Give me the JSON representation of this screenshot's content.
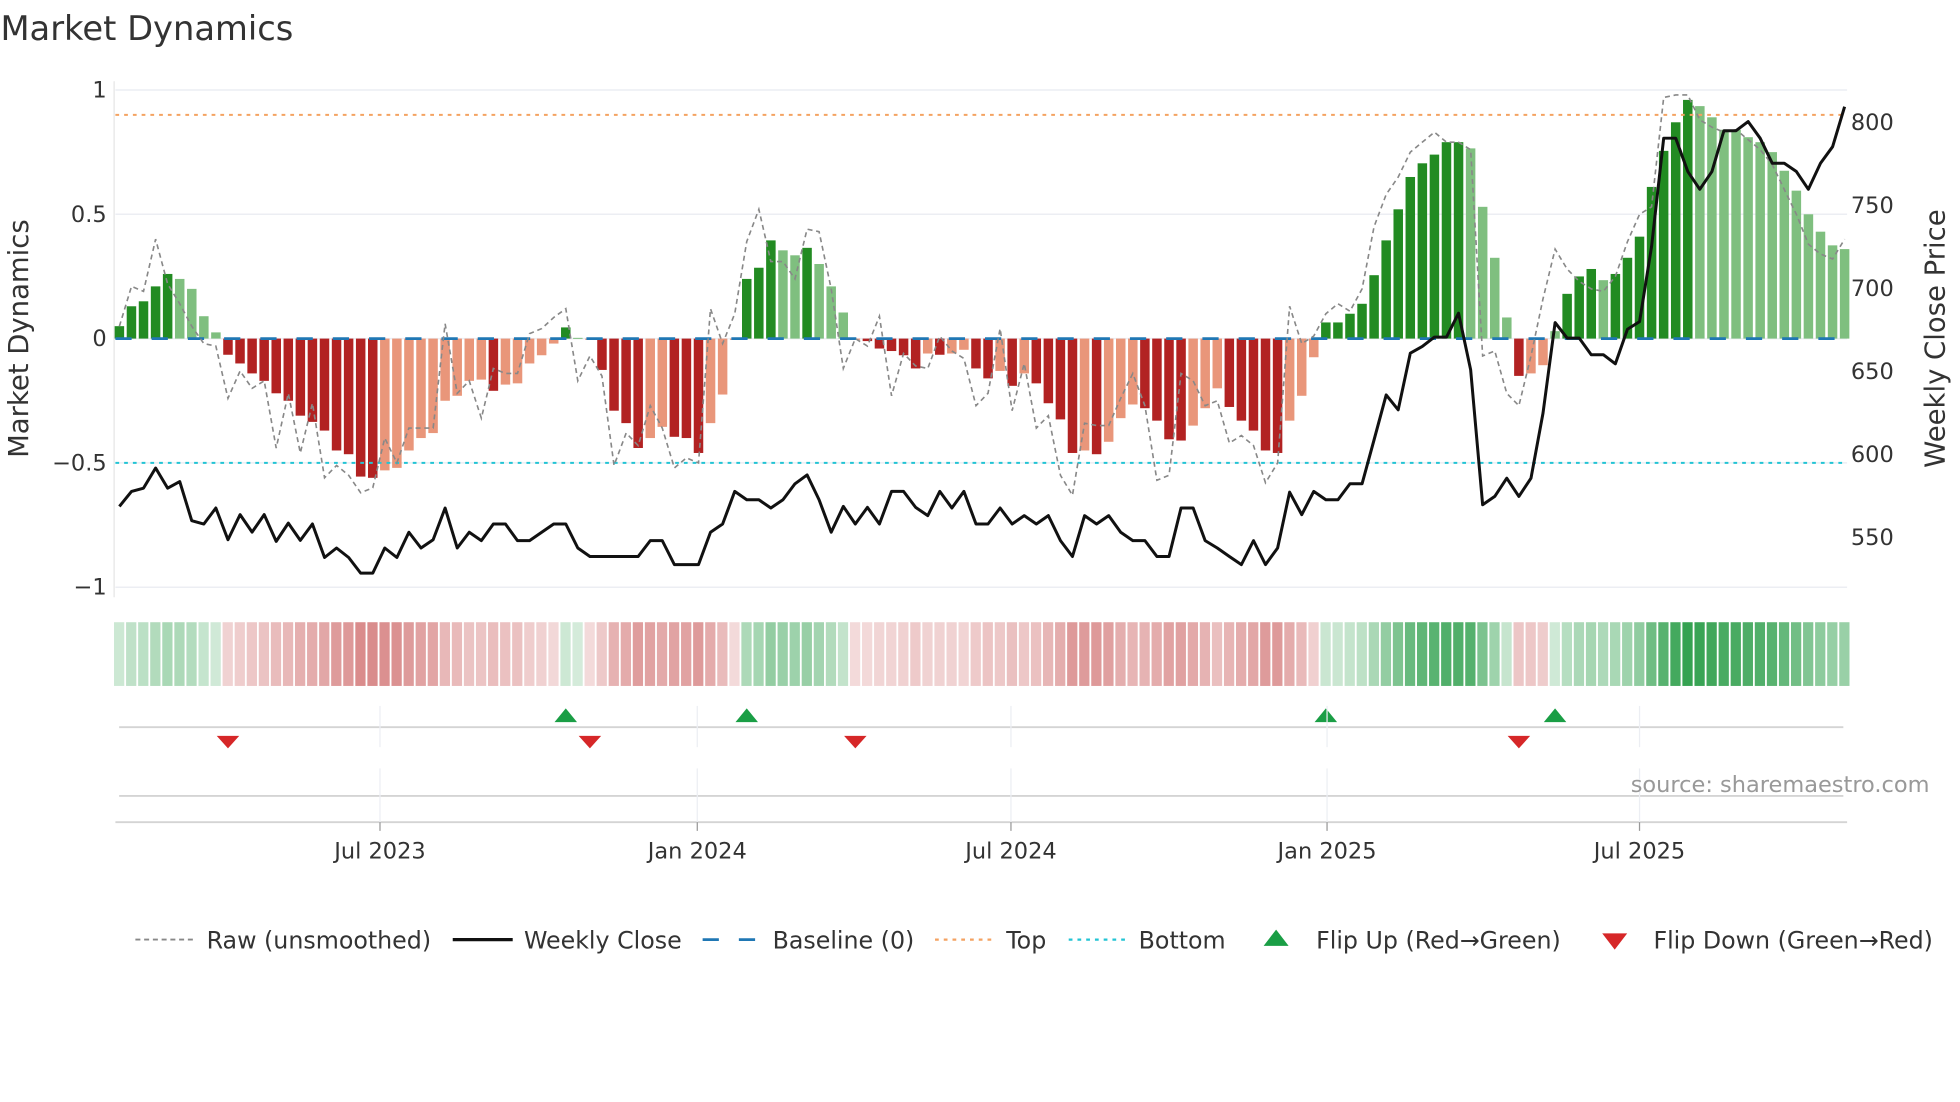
{
  "chart_data": {
    "type": "bar",
    "title": "Market Dynamics",
    "ylabel": "Market Dynamics",
    "y2label": "Weekly Close Price",
    "ylim": [
      -1,
      1
    ],
    "y2lim": [
      520,
      826
    ],
    "yticks": [
      {
        "v": 1,
        "label": "1"
      },
      {
        "v": 0.5,
        "label": "0.5"
      },
      {
        "v": 0,
        "label": "0"
      },
      {
        "v": -0.5,
        "label": "−0.5"
      },
      {
        "v": -1,
        "label": "−1"
      }
    ],
    "y2ticks": [
      {
        "v": 800,
        "label": "800"
      },
      {
        "v": 750,
        "label": "750"
      },
      {
        "v": 700,
        "label": "700"
      },
      {
        "v": 650,
        "label": "650"
      },
      {
        "v": 600,
        "label": "600"
      },
      {
        "v": 550,
        "label": "550"
      }
    ],
    "xticks": [
      {
        "week": 22.6,
        "label": "Jul 2023"
      },
      {
        "week": 48.9,
        "label": "Jan 2024"
      },
      {
        "week": 74.9,
        "label": "Jul 2024"
      },
      {
        "week": 101.1,
        "label": "Jan 2025"
      },
      {
        "week": 127,
        "label": "Jul 2025"
      }
    ],
    "frequency": "weekly",
    "reference_lines": {
      "top": 0.9,
      "bottom": -0.5,
      "baseline": 0
    },
    "smoothed": [
      0.05,
      0.13,
      0.15,
      0.21,
      0.26,
      0.24,
      0.2,
      0.09,
      0.025,
      -0.065,
      -0.1,
      -0.14,
      -0.17,
      -0.22,
      -0.25,
      -0.31,
      -0.335,
      -0.37,
      -0.45,
      -0.465,
      -0.555,
      -0.56,
      -0.53,
      -0.52,
      -0.45,
      -0.4,
      -0.38,
      -0.25,
      -0.23,
      -0.17,
      -0.165,
      -0.21,
      -0.185,
      -0.18,
      -0.1,
      -0.067,
      -0.02,
      0.045,
      0.003,
      -0.005,
      -0.126,
      -0.29,
      -0.34,
      -0.44,
      -0.4,
      -0.355,
      -0.395,
      -0.4,
      -0.46,
      -0.34,
      -0.225,
      -0.005,
      0.24,
      0.285,
      0.395,
      0.355,
      0.335,
      0.365,
      0.3,
      0.21,
      0.105,
      -0.005,
      -0.01,
      -0.04,
      -0.05,
      -0.067,
      -0.12,
      -0.06,
      -0.065,
      -0.06,
      -0.045,
      -0.12,
      -0.16,
      -0.13,
      -0.19,
      -0.14,
      -0.18,
      -0.26,
      -0.325,
      -0.46,
      -0.45,
      -0.465,
      -0.415,
      -0.32,
      -0.265,
      -0.28,
      -0.33,
      -0.405,
      -0.41,
      -0.35,
      -0.28,
      -0.2,
      -0.275,
      -0.33,
      -0.37,
      -0.45,
      -0.46,
      -0.33,
      -0.23,
      -0.075,
      0.065,
      0.065,
      0.1,
      0.14,
      0.255,
      0.395,
      0.52,
      0.65,
      0.705,
      0.74,
      0.79,
      0.79,
      0.765,
      0.53,
      0.325,
      0.085,
      -0.15,
      -0.14,
      -0.107,
      0.03,
      0.18,
      0.25,
      0.28,
      0.235,
      0.26,
      0.325,
      0.41,
      0.61,
      0.755,
      0.87,
      0.96,
      0.935,
      0.89,
      0.84,
      0.84,
      0.81,
      0.79,
      0.75,
      0.675,
      0.595,
      0.5,
      0.43,
      0.375,
      0.36
    ],
    "state": [
      "DG",
      "DG",
      "DG",
      "DG",
      "DG",
      "LG",
      "LG",
      "LG",
      "LG",
      "DR",
      "DR",
      "DR",
      "DR",
      "DR",
      "DR",
      "DR",
      "DR",
      "DR",
      "DR",
      "DR",
      "DR",
      "DR",
      "LR",
      "LR",
      "LR",
      "LR",
      "LR",
      "LR",
      "LR",
      "LR",
      "LR",
      "DR",
      "LR",
      "LR",
      "LR",
      "LR",
      "LR",
      "DG",
      "LG",
      "LR",
      "DR",
      "DR",
      "DR",
      "DR",
      "LR",
      "LR",
      "DR",
      "DR",
      "DR",
      "LR",
      "LR",
      "LR",
      "DG",
      "DG",
      "DG",
      "LG",
      "LG",
      "DG",
      "LG",
      "LG",
      "LG",
      "LR",
      "DR",
      "DR",
      "DR",
      "DR",
      "DR",
      "LR",
      "DR",
      "LR",
      "LR",
      "DR",
      "DR",
      "LR",
      "DR",
      "LR",
      "DR",
      "DR",
      "DR",
      "DR",
      "LR",
      "DR",
      "LR",
      "LR",
      "LR",
      "DR",
      "DR",
      "DR",
      "DR",
      "LR",
      "LR",
      "LR",
      "DR",
      "DR",
      "DR",
      "DR",
      "DR",
      "LR",
      "LR",
      "LR",
      "DG",
      "DG",
      "DG",
      "DG",
      "DG",
      "DG",
      "DG",
      "DG",
      "DG",
      "DG",
      "DG",
      "DG",
      "LG",
      "LG",
      "LG",
      "LG",
      "DR",
      "LR",
      "LR",
      "LG",
      "DG",
      "DG",
      "DG",
      "LG",
      "DG",
      "DG",
      "DG",
      "DG",
      "DG",
      "DG",
      "DG",
      "LG",
      "LG",
      "LG",
      "LG",
      "LG",
      "LG",
      "LG",
      "LG",
      "LG",
      "LG",
      "LG",
      "LG",
      "LG"
    ],
    "raw": [
      0.05,
      0.21,
      0.19,
      0.4,
      0.22,
      0.14,
      0.05,
      -0.02,
      -0.03,
      -0.24,
      -0.13,
      -0.2,
      -0.17,
      -0.44,
      -0.22,
      -0.46,
      -0.26,
      -0.56,
      -0.51,
      -0.55,
      -0.62,
      -0.6,
      -0.4,
      -0.5,
      -0.36,
      -0.36,
      -0.36,
      0.06,
      -0.22,
      -0.17,
      -0.32,
      -0.12,
      -0.14,
      -0.14,
      0.02,
      0.04,
      0.085,
      0.12,
      -0.17,
      -0.07,
      -0.15,
      -0.51,
      -0.38,
      -0.43,
      -0.27,
      -0.36,
      -0.52,
      -0.48,
      -0.5,
      0.12,
      -0.02,
      0.1,
      0.39,
      0.52,
      0.31,
      0.31,
      0.24,
      0.44,
      0.43,
      0.2,
      -0.12,
      0.0,
      -0.03,
      0.09,
      -0.23,
      -0.06,
      -0.11,
      -0.12,
      0.01,
      -0.05,
      -0.08,
      -0.27,
      -0.22,
      0.04,
      -0.29,
      -0.1,
      -0.36,
      -0.31,
      -0.55,
      -0.63,
      -0.34,
      -0.35,
      -0.35,
      -0.24,
      -0.14,
      -0.27,
      -0.57,
      -0.55,
      -0.14,
      -0.17,
      -0.27,
      -0.25,
      -0.42,
      -0.39,
      -0.43,
      -0.58,
      -0.5,
      0.13,
      -0.02,
      0.01,
      0.1,
      0.14,
      0.11,
      0.2,
      0.45,
      0.58,
      0.65,
      0.75,
      0.79,
      0.83,
      0.79,
      0.79,
      0.76,
      -0.07,
      -0.05,
      -0.22,
      -0.27,
      -0.07,
      0.16,
      0.36,
      0.28,
      0.23,
      0.2,
      0.19,
      0.25,
      0.39,
      0.5,
      0.53,
      0.97,
      0.98,
      0.98,
      0.88,
      0.85,
      0.83,
      0.84,
      0.8,
      0.76,
      0.7,
      0.6,
      0.5,
      0.38,
      0.34,
      0.32,
      0.4
    ],
    "close": [
      568.6,
      577.6,
      579.6,
      591.7,
      579.6,
      583.6,
      560,
      558,
      567.6,
      548.5,
      563.6,
      553.1,
      563.6,
      547.5,
      558.5,
      548.1,
      558,
      537.8,
      543.5,
      537.8,
      528.4,
      528.4,
      543.5,
      537.8,
      553,
      543.5,
      548.5,
      567.6,
      543.5,
      553,
      548,
      558,
      558,
      548,
      548,
      553,
      558,
      558,
      543.5,
      538.4,
      538.4,
      538.4,
      538.4,
      538.4,
      548,
      548,
      533.5,
      533.5,
      533.5,
      553,
      558,
      577.6,
      572.6,
      572.6,
      567.6,
      572.6,
      582.2,
      587.6,
      572.6,
      553,
      568.6,
      558,
      568,
      558,
      577.6,
      577.6,
      568,
      563,
      577.6,
      567.6,
      577.6,
      558,
      558,
      567.6,
      558,
      563,
      558,
      563,
      548,
      538.4,
      563,
      558,
      563,
      553,
      548,
      548,
      538.4,
      538.4,
      567.6,
      567.6,
      548,
      543.5,
      538.4,
      533.5,
      548,
      533.5,
      543.5,
      577.2,
      563.6,
      577.6,
      572.6,
      572.6,
      582.2,
      582.2,
      608.7,
      635.8,
      626.8,
      660.9,
      665,
      670.6,
      670.6,
      685,
      650.9,
      569.6,
      574.6,
      585.6,
      574.6,
      585.6,
      624.8,
      679.4,
      670,
      670,
      660,
      660,
      654.5,
      675.4,
      680,
      725.2,
      790.5,
      790.5,
      770.4,
      759.7,
      770.4,
      795,
      795,
      800.5,
      790.5,
      775.4,
      775.4,
      770.4,
      759.7,
      775.4,
      785.4,
      809.5
    ],
    "flip_up_weeks": [
      38,
      53,
      101,
      120
    ],
    "flip_down_weeks": [
      10,
      40,
      62,
      117
    ],
    "legend": {
      "placement": "bottom",
      "items": [
        {
          "key": "raw",
          "label": "Raw (unsmoothed)"
        },
        {
          "key": "close",
          "label": "Weekly Close"
        },
        {
          "key": "baseline",
          "label": "Baseline (0)"
        },
        {
          "key": "top",
          "label": "Top"
        },
        {
          "key": "bottom",
          "label": "Bottom"
        },
        {
          "key": "flip_up",
          "label": "Flip Up (Red→Green)"
        },
        {
          "key": "flip_down",
          "label": "Flip Down (Green→Red)"
        }
      ]
    },
    "source": "source: sharemaestro.com"
  },
  "colors": {
    "DG": "#228b22",
    "LG": "#7fbf7f",
    "DR": "#b22222",
    "LR": "#e9967a",
    "strip_green": "#2a9d48",
    "strip_red": "#c44a4a",
    "top": "#f4a261",
    "bottom": "#22c4d4",
    "baseline": "#1f77b4",
    "raw": "#888888",
    "close": "#111111",
    "flip_up": "#1a9e45",
    "flip_down": "#d62728"
  }
}
